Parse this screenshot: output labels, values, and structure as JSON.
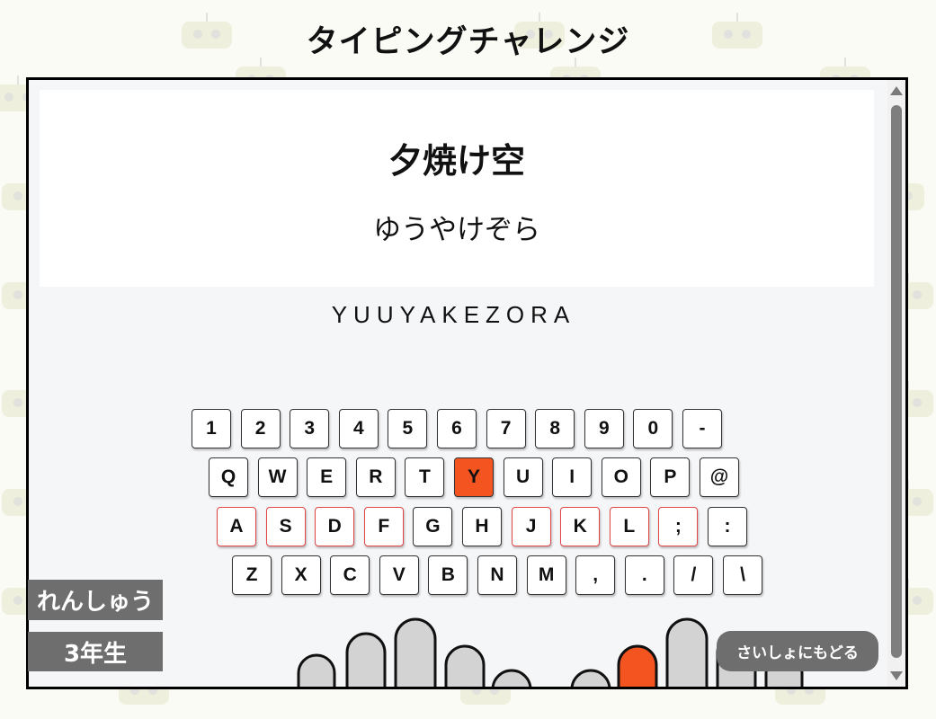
{
  "title": "タイピングチャレンジ",
  "word": {
    "kanji": "夕焼け空",
    "kana": "ゆうやけぞら",
    "romaji": "YUUYAKEZORA"
  },
  "keyboard": {
    "rows": [
      [
        "1",
        "2",
        "3",
        "4",
        "5",
        "6",
        "7",
        "8",
        "9",
        "0",
        "-"
      ],
      [
        "Q",
        "W",
        "E",
        "R",
        "T",
        "Y",
        "U",
        "I",
        "O",
        "P",
        "@"
      ],
      [
        "A",
        "S",
        "D",
        "F",
        "G",
        "H",
        "J",
        "K",
        "L",
        ";",
        ":"
      ],
      [
        "Z",
        "X",
        "C",
        "V",
        "B",
        "N",
        "M",
        ",",
        ".",
        "/",
        "\\"
      ]
    ],
    "active_key": "Y",
    "home_keys": [
      "A",
      "S",
      "D",
      "F",
      "J",
      "K",
      "L",
      ";"
    ]
  },
  "fingers": {
    "active_finger": "right-index"
  },
  "mode_badge": "れんしゅう",
  "grade_badge": "3年生",
  "back_button": "さいしょにもどる",
  "colors": {
    "active": "#f4541f",
    "home_border": "#e34646",
    "badge": "#6e6e6e"
  }
}
